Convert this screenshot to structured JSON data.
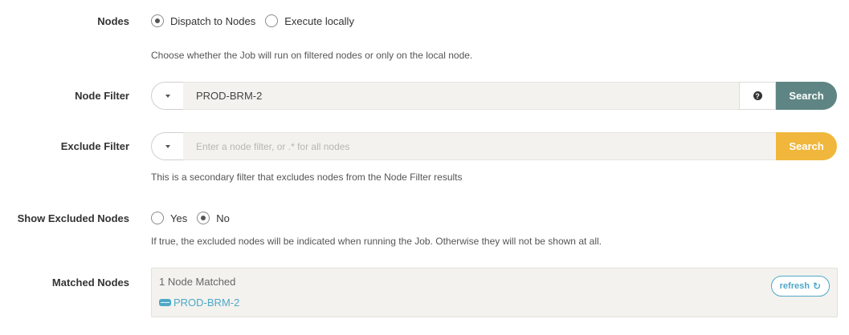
{
  "nodes": {
    "label": "Nodes",
    "option_dispatch": "Dispatch to Nodes",
    "option_local": "Execute locally",
    "selected": "dispatch",
    "help": "Choose whether the Job will run on filtered nodes or only on the local node."
  },
  "node_filter": {
    "label": "Node Filter",
    "value": "PROD-BRM-2",
    "search_label": "Search",
    "search_color": "#5e8584",
    "help_icon": "question-circle-icon"
  },
  "exclude_filter": {
    "label": "Exclude Filter",
    "placeholder": "Enter a node filter, or .* for all nodes",
    "search_label": "Search",
    "search_color": "#f0b73c",
    "help": "This is a secondary filter that excludes nodes from the Node Filter results"
  },
  "show_excluded": {
    "label": "Show Excluded Nodes",
    "option_yes": "Yes",
    "option_no": "No",
    "selected": "no",
    "help": "If true, the excluded nodes will be indicated when running the Job. Otherwise they will not be shown at all."
  },
  "matched": {
    "label": "Matched Nodes",
    "count_text": "1 Node Matched",
    "node": "PROD-BRM-2",
    "refresh_label": "refresh",
    "accent": "#4fa8c7"
  }
}
